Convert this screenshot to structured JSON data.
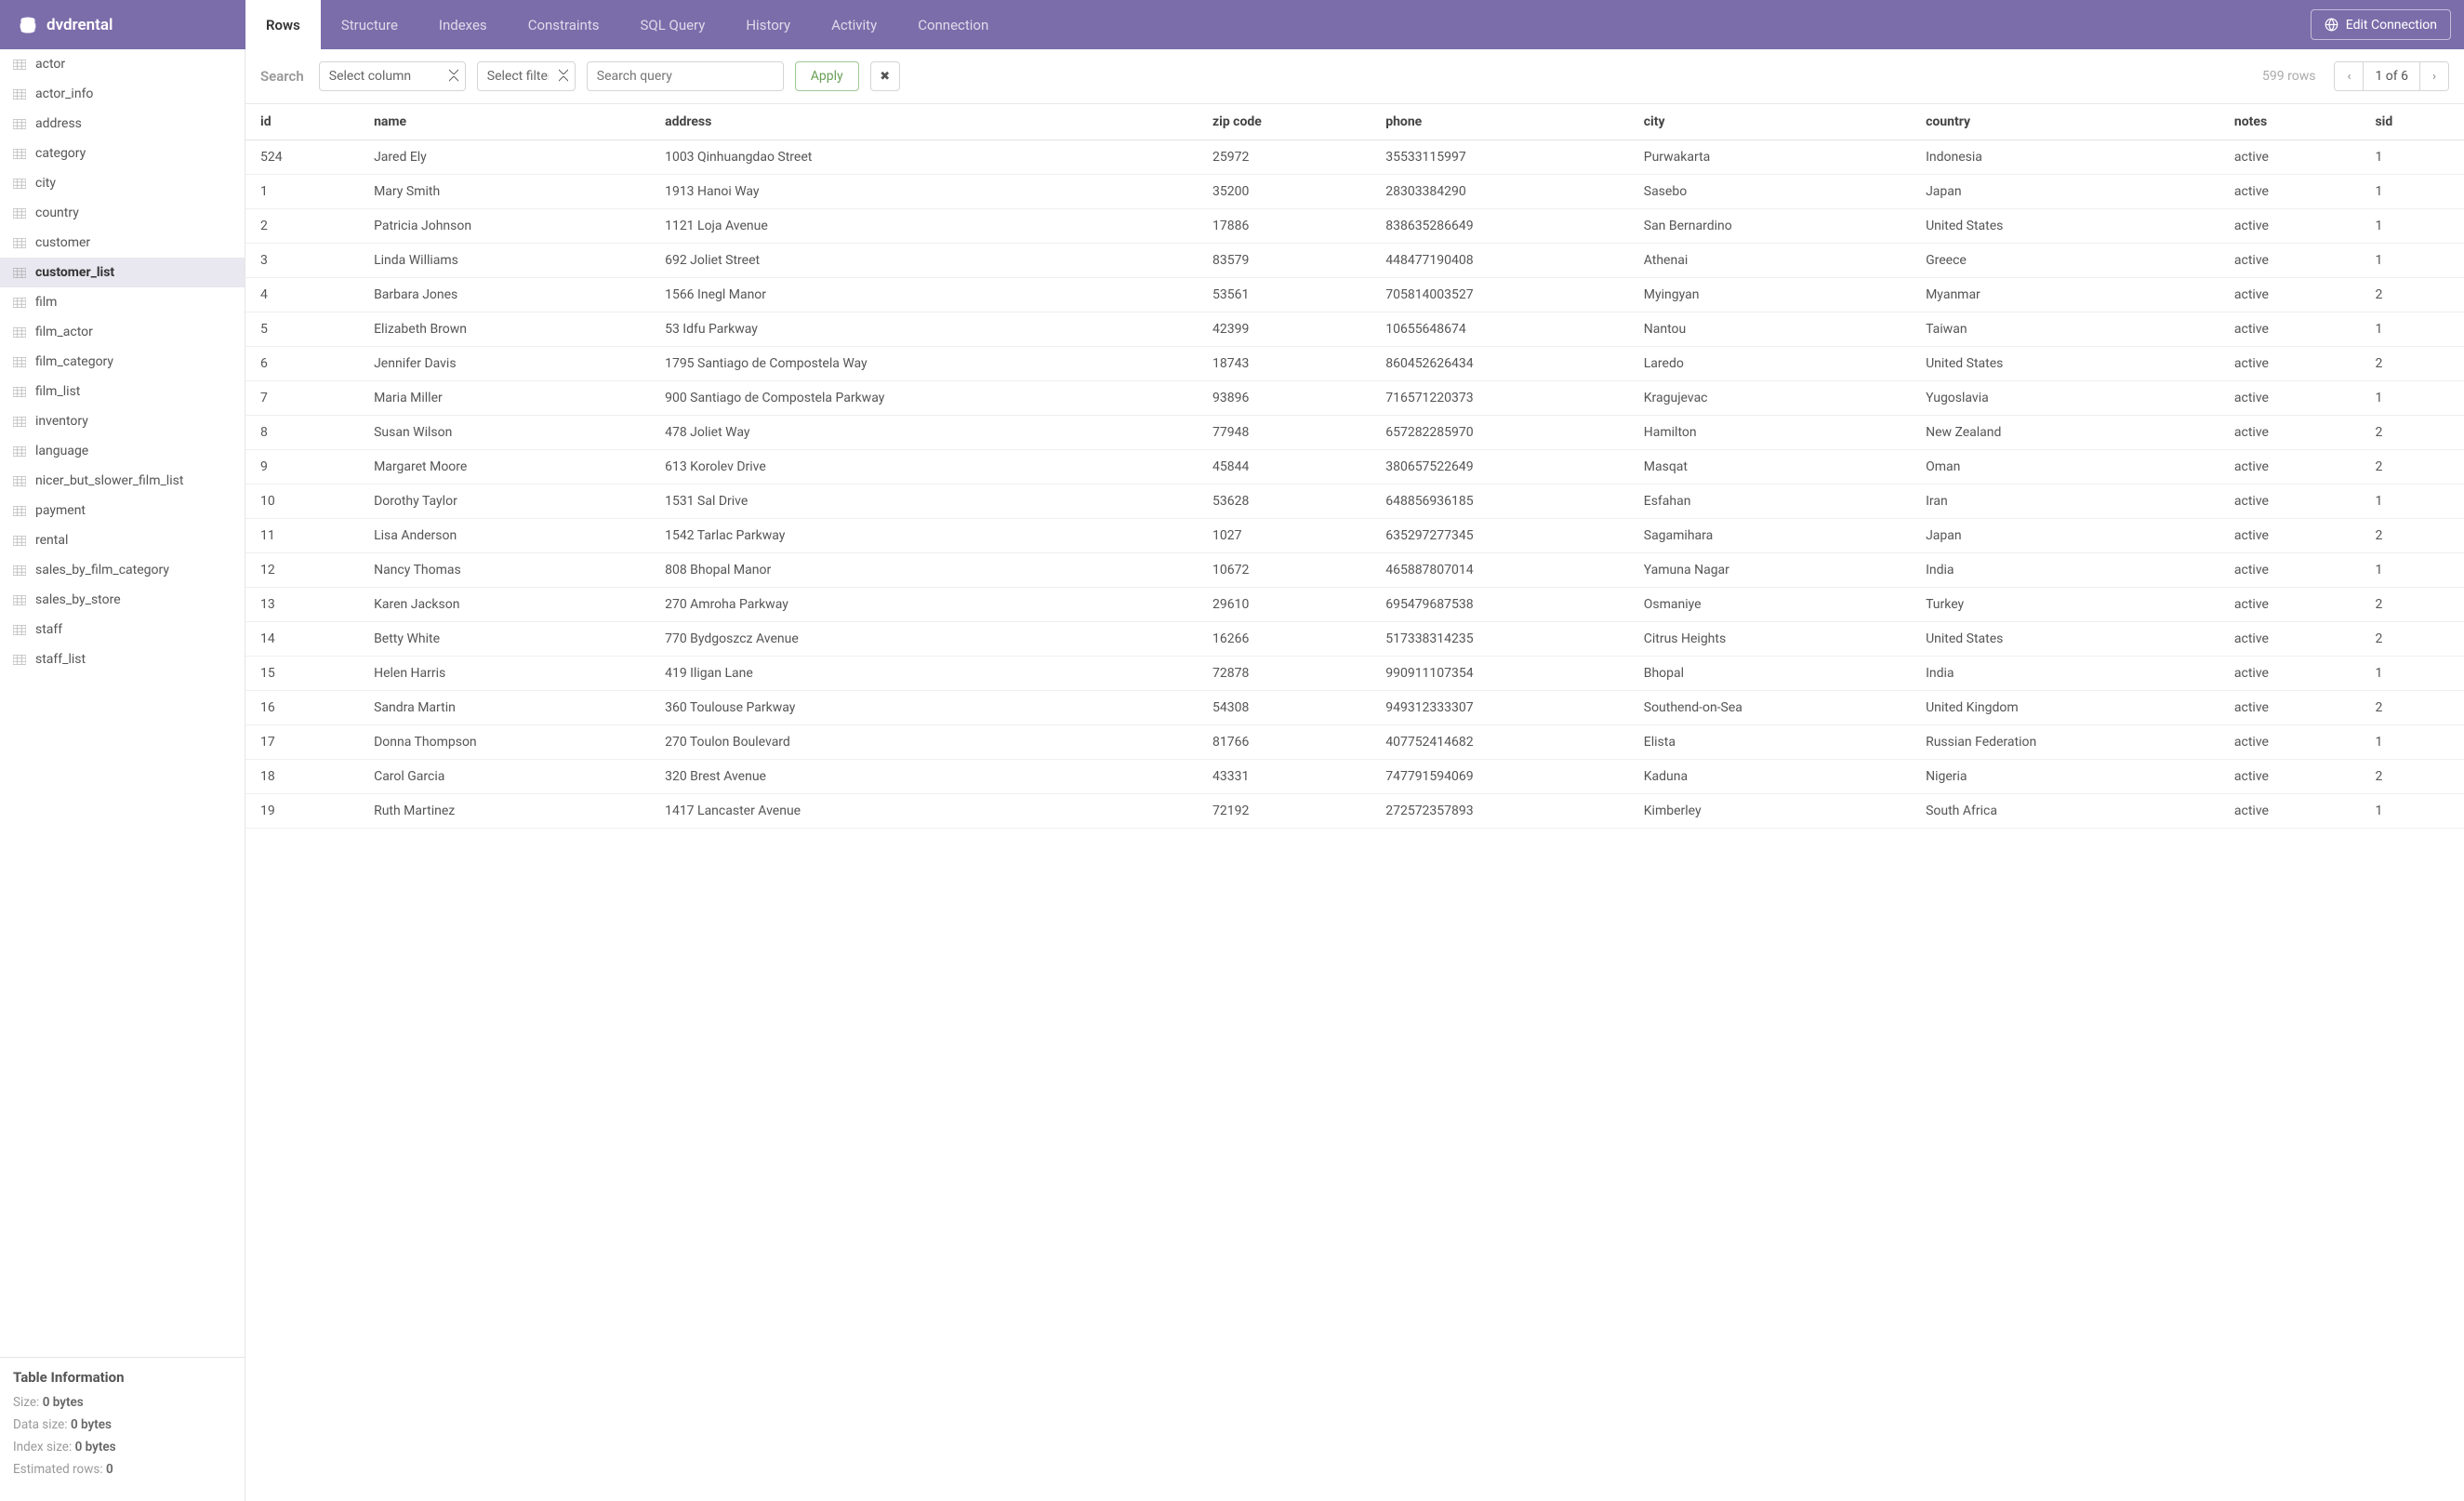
{
  "brand": {
    "name": "dvdrental"
  },
  "nav_tabs": [
    {
      "label": "Rows",
      "active": true
    },
    {
      "label": "Structure"
    },
    {
      "label": "Indexes"
    },
    {
      "label": "Constraints"
    },
    {
      "label": "SQL Query"
    },
    {
      "label": "History"
    },
    {
      "label": "Activity"
    },
    {
      "label": "Connection"
    }
  ],
  "edit_connection_label": "Edit Connection",
  "sidebar": {
    "items": [
      {
        "name": "actor"
      },
      {
        "name": "actor_info"
      },
      {
        "name": "address"
      },
      {
        "name": "category"
      },
      {
        "name": "city"
      },
      {
        "name": "country"
      },
      {
        "name": "customer"
      },
      {
        "name": "customer_list",
        "active": true
      },
      {
        "name": "film"
      },
      {
        "name": "film_actor"
      },
      {
        "name": "film_category"
      },
      {
        "name": "film_list"
      },
      {
        "name": "inventory"
      },
      {
        "name": "language"
      },
      {
        "name": "nicer_but_slower_film_list"
      },
      {
        "name": "payment"
      },
      {
        "name": "rental"
      },
      {
        "name": "sales_by_film_category"
      },
      {
        "name": "sales_by_store"
      },
      {
        "name": "staff"
      },
      {
        "name": "staff_list"
      }
    ],
    "info": {
      "title": "Table Information",
      "size_label": "Size:",
      "size_value": "0 bytes",
      "data_size_label": "Data size:",
      "data_size_value": "0 bytes",
      "index_size_label": "Index size:",
      "index_size_value": "0 bytes",
      "est_rows_label": "Estimated rows:",
      "est_rows_value": "0"
    }
  },
  "search": {
    "label": "Search",
    "column_placeholder": "Select column",
    "filter_placeholder": "Select filter",
    "query_placeholder": "Search query",
    "apply_label": "Apply"
  },
  "pager": {
    "rows_text": "599 rows",
    "position": "1 of 6"
  },
  "table": {
    "columns": [
      "id",
      "name",
      "address",
      "zip code",
      "phone",
      "city",
      "country",
      "notes",
      "sid"
    ],
    "rows": [
      [
        "524",
        "Jared Ely",
        "1003 Qinhuangdao Street",
        "25972",
        "35533115997",
        "Purwakarta",
        "Indonesia",
        "active",
        "1"
      ],
      [
        "1",
        "Mary Smith",
        "1913 Hanoi Way",
        "35200",
        "28303384290",
        "Sasebo",
        "Japan",
        "active",
        "1"
      ],
      [
        "2",
        "Patricia Johnson",
        "1121 Loja Avenue",
        "17886",
        "838635286649",
        "San Bernardino",
        "United States",
        "active",
        "1"
      ],
      [
        "3",
        "Linda Williams",
        "692 Joliet Street",
        "83579",
        "448477190408",
        "Athenai",
        "Greece",
        "active",
        "1"
      ],
      [
        "4",
        "Barbara Jones",
        "1566 Inegl Manor",
        "53561",
        "705814003527",
        "Myingyan",
        "Myanmar",
        "active",
        "2"
      ],
      [
        "5",
        "Elizabeth Brown",
        "53 Idfu Parkway",
        "42399",
        "10655648674",
        "Nantou",
        "Taiwan",
        "active",
        "1"
      ],
      [
        "6",
        "Jennifer Davis",
        "1795 Santiago de Compostela Way",
        "18743",
        "860452626434",
        "Laredo",
        "United States",
        "active",
        "2"
      ],
      [
        "7",
        "Maria Miller",
        "900 Santiago de Compostela Parkway",
        "93896",
        "716571220373",
        "Kragujevac",
        "Yugoslavia",
        "active",
        "1"
      ],
      [
        "8",
        "Susan Wilson",
        "478 Joliet Way",
        "77948",
        "657282285970",
        "Hamilton",
        "New Zealand",
        "active",
        "2"
      ],
      [
        "9",
        "Margaret Moore",
        "613 Korolev Drive",
        "45844",
        "380657522649",
        "Masqat",
        "Oman",
        "active",
        "2"
      ],
      [
        "10",
        "Dorothy Taylor",
        "1531 Sal Drive",
        "53628",
        "648856936185",
        "Esfahan",
        "Iran",
        "active",
        "1"
      ],
      [
        "11",
        "Lisa Anderson",
        "1542 Tarlac Parkway",
        "1027",
        "635297277345",
        "Sagamihara",
        "Japan",
        "active",
        "2"
      ],
      [
        "12",
        "Nancy Thomas",
        "808 Bhopal Manor",
        "10672",
        "465887807014",
        "Yamuna Nagar",
        "India",
        "active",
        "1"
      ],
      [
        "13",
        "Karen Jackson",
        "270 Amroha Parkway",
        "29610",
        "695479687538",
        "Osmaniye",
        "Turkey",
        "active",
        "2"
      ],
      [
        "14",
        "Betty White",
        "770 Bydgoszcz Avenue",
        "16266",
        "517338314235",
        "Citrus Heights",
        "United States",
        "active",
        "2"
      ],
      [
        "15",
        "Helen Harris",
        "419 Iligan Lane",
        "72878",
        "990911107354",
        "Bhopal",
        "India",
        "active",
        "1"
      ],
      [
        "16",
        "Sandra Martin",
        "360 Toulouse Parkway",
        "54308",
        "949312333307",
        "Southend-on-Sea",
        "United Kingdom",
        "active",
        "2"
      ],
      [
        "17",
        "Donna Thompson",
        "270 Toulon Boulevard",
        "81766",
        "407752414682",
        "Elista",
        "Russian Federation",
        "active",
        "1"
      ],
      [
        "18",
        "Carol Garcia",
        "320 Brest Avenue",
        "43331",
        "747791594069",
        "Kaduna",
        "Nigeria",
        "active",
        "2"
      ],
      [
        "19",
        "Ruth Martinez",
        "1417 Lancaster Avenue",
        "72192",
        "272572357893",
        "Kimberley",
        "South Africa",
        "active",
        "1"
      ]
    ]
  }
}
